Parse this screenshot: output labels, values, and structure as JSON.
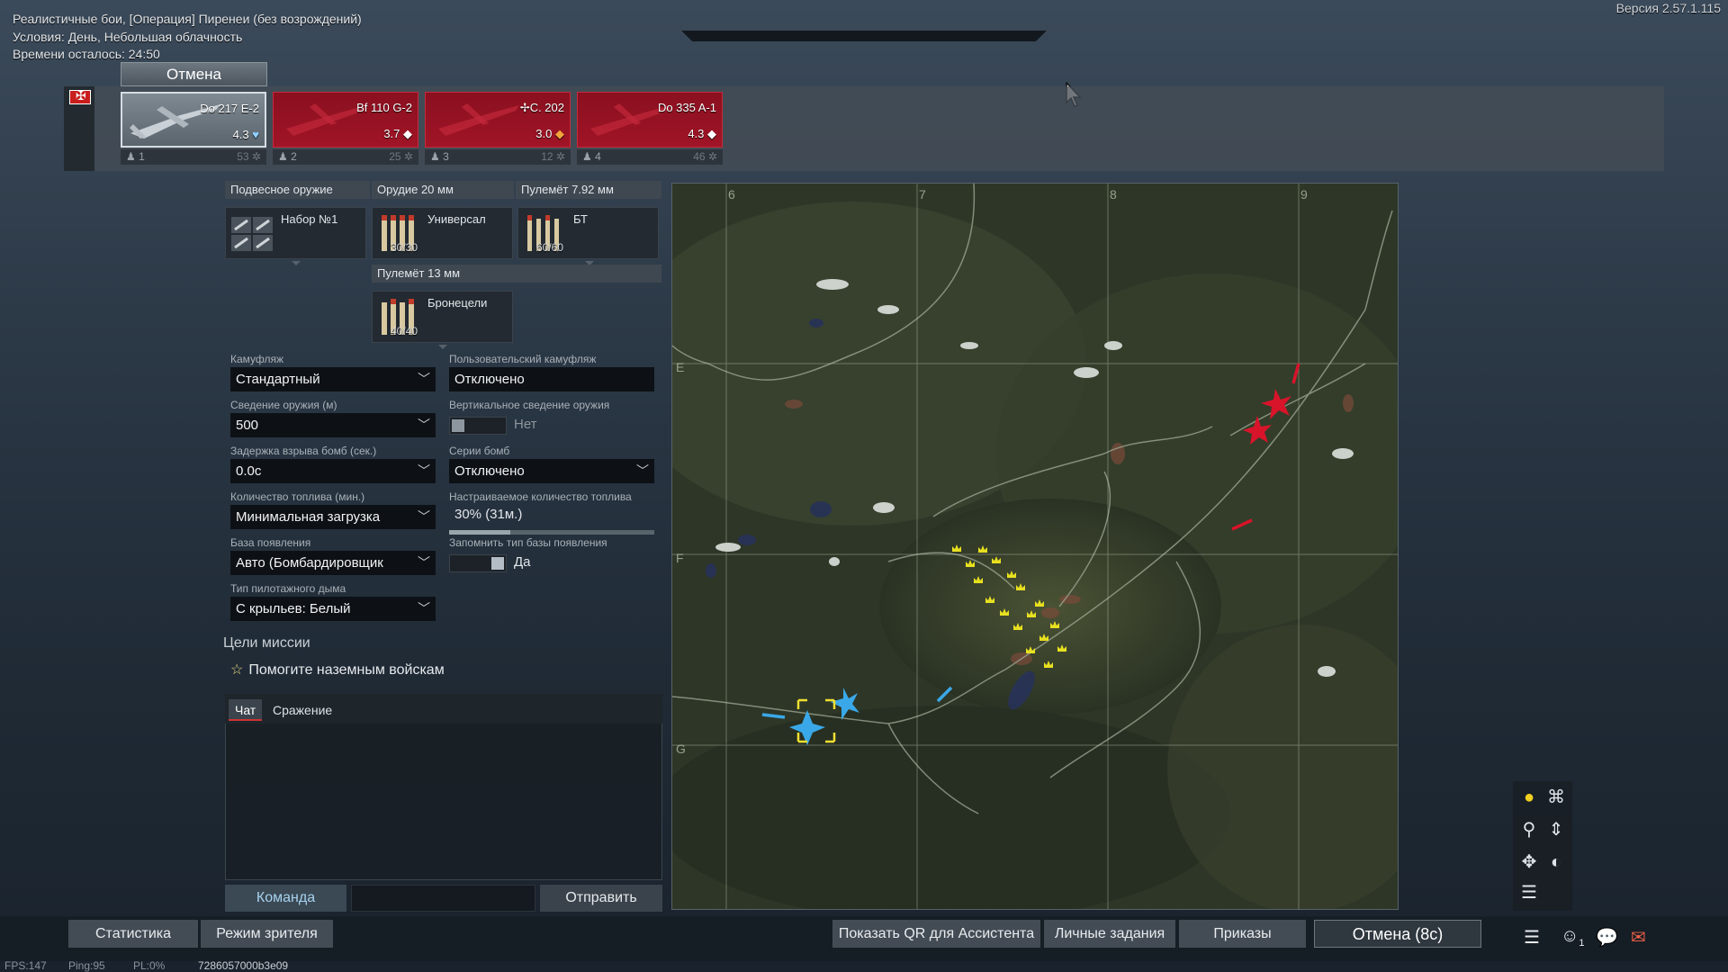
{
  "header": {
    "mode": "Реалистичные бои, [Операция] Пиренеи (без возрождений)",
    "conditions": "Условия: День, Небольшая облачность",
    "time_left": "Времени осталось: 24:50",
    "version": "Версия 2.57.1.115",
    "cancel_top": "Отмена"
  },
  "slots": [
    {
      "name": "Do 217 E-2",
      "br": "4.3",
      "crew": "1",
      "cost": "53",
      "selected": true
    },
    {
      "name": "Bf 110 G-2",
      "br": "3.7",
      "crew": "2",
      "cost": "25",
      "selected": false
    },
    {
      "name": "C. 202",
      "br": "3.0",
      "crew": "3",
      "cost": "12",
      "selected": false
    },
    {
      "name": "Do 335 A-1",
      "br": "4.3",
      "crew": "4",
      "cost": "46",
      "selected": false
    }
  ],
  "weapons": {
    "suspended": {
      "header": "Подвесное оружие",
      "label": "Набор №1"
    },
    "cannon20": {
      "header": "Орудие 20 мм",
      "label": "Универсал",
      "count": "30/30"
    },
    "mg792": {
      "header": "Пулемёт 7.92 мм",
      "label": "БТ",
      "count": "60/60"
    },
    "mg13": {
      "header": "Пулемёт 13 мм",
      "label": "Бронецели",
      "count": "40/40"
    }
  },
  "options": {
    "camo_label": "Камуфляж",
    "camo_value": "Стандартный",
    "custom_camo_label": "Пользовательский камуфляж",
    "custom_camo_value": "Отключено",
    "convergence_label": "Сведение оружия (м)",
    "convergence_value": "500",
    "vert_conv_label": "Вертикальное сведение оружия",
    "vert_conv_value": "Нет",
    "bomb_delay_label": "Задержка взрыва бомб (сек.)",
    "bomb_delay_value": "0.0с",
    "bomb_series_label": "Серии бомб",
    "bomb_series_value": "Отключено",
    "fuel_label": "Количество топлива (мин.)",
    "fuel_value": "Минимальная загрузка",
    "custom_fuel_label": "Настраиваемое количество топлива",
    "custom_fuel_value": "30% (31м.)",
    "custom_fuel_fraction": 0.3,
    "spawn_label": "База появления",
    "spawn_value": "Авто (Бомбардировщик",
    "remember_spawn_label": "Запомнить тип базы появления",
    "remember_spawn_value": "Да",
    "smoke_label": "Тип пилотажного дыма",
    "smoke_value": "С крыльев: Белый"
  },
  "mission": {
    "title": "Цели миссии",
    "objective": "Помогите наземным войскам"
  },
  "chat": {
    "tab_chat": "Чат",
    "tab_battle": "Сражение",
    "command": "Команда",
    "send": "Отправить"
  },
  "map": {
    "cols": [
      "6",
      "7",
      "8",
      "9"
    ],
    "rows": [
      "E",
      "F",
      "G"
    ]
  },
  "bottom": {
    "stats_btn": "Статистика",
    "spectator_btn": "Режим зрителя",
    "qr_btn": "Показать QR для Ассистента",
    "tasks_btn": "Личные задания",
    "orders_btn": "Приказы",
    "cancel_btn": "Отмена (8с)",
    "fps": "FPS:147",
    "ping": "Ping:95",
    "pl": "PL:0%",
    "session": "7286057000b3e09",
    "squad_count": "1"
  },
  "colors": {
    "enemy": "#d8142a",
    "ally": "#3aa8e8",
    "objective": "#e8e020"
  }
}
